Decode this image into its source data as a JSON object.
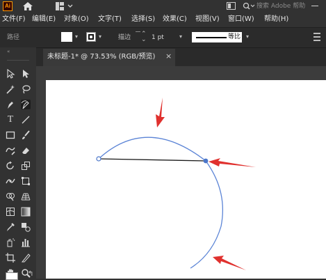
{
  "app_logo": "Ai",
  "titlebar": {
    "home_icon": "home-icon",
    "workspace_icon": "workspace-icon",
    "search_placeholder": "搜索 Adobe 帮助"
  },
  "menu": [
    "文件(F)",
    "编辑(E)",
    "对象(O)",
    "文字(T)",
    "选择(S)",
    "效果(C)",
    "视图(V)",
    "窗口(W)",
    "帮助(H)"
  ],
  "control_bar": {
    "path_label": "路径",
    "stroke_label": "描边",
    "stroke_weight": "1 pt",
    "profile_label": "等比"
  },
  "document_tab": {
    "title": "未标题-1* @ 73.53% (RGB/预览)",
    "close": "×"
  },
  "colors": {
    "ui_bg": "#323232",
    "accent_arrow": "#e0312e",
    "path_blue": "#4a76c9"
  }
}
